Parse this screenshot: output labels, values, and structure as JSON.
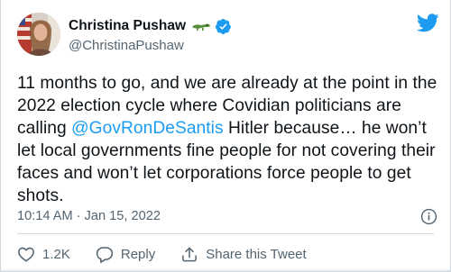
{
  "author": {
    "display_name": "Christina Pushaw",
    "handle": "@ChristinaPushaw"
  },
  "tweet": {
    "text_parts": {
      "before_mention": "11 months to go, and we are already at the point in the 2022 election cycle where Covidian politicians are calling ",
      "mention": "@GovRonDeSantis",
      "after_mention": " Hitler because… he won’t let local governments fine people for not covering their faces and won’t let corporations force people to get shots."
    },
    "time": "10:14 AM",
    "separator": "·",
    "date": "Jan 15, 2022"
  },
  "actions": {
    "like_count": "1.2K",
    "reply_label": "Reply",
    "share_label": "Share this Tweet"
  },
  "icons": {
    "brand": "twitter-bird-icon",
    "verified": "verified-badge-icon",
    "emoji": "alligator-emoji-icon",
    "info": "info-icon",
    "like": "heart-icon",
    "reply": "reply-bubble-icon",
    "share": "share-arrow-icon"
  },
  "colors": {
    "accent": "#1d9bf0",
    "text": "#0f1419",
    "secondary": "#536471",
    "gator": "#5a8f3c"
  }
}
